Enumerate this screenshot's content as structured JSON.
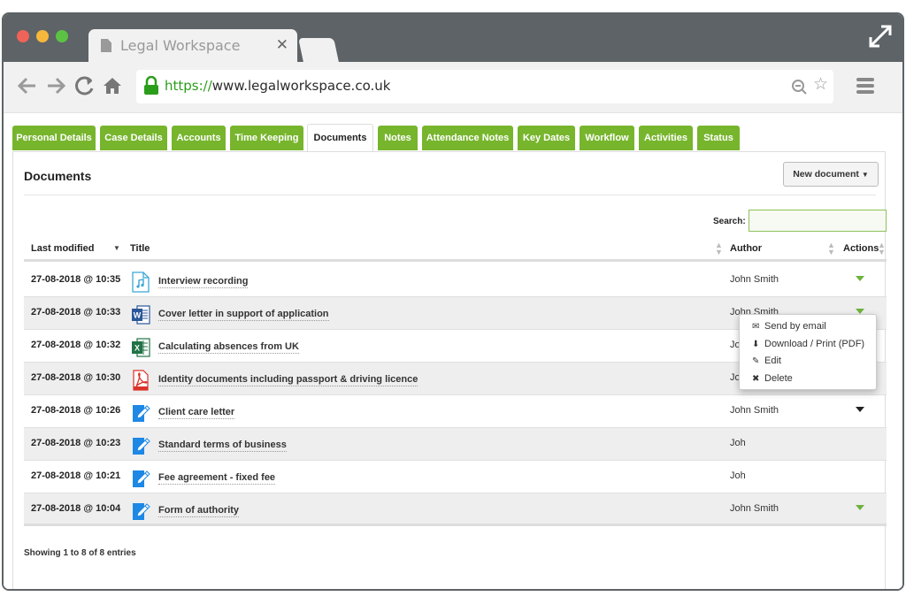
{
  "browser": {
    "tab_title": "Legal Workspace",
    "tab_close": "✕",
    "url_scheme": "https://",
    "url_host": "www.legalworkspace.co.uk"
  },
  "app_tabs": [
    {
      "label": "Personal Details",
      "active": false
    },
    {
      "label": "Case Details",
      "active": false
    },
    {
      "label": "Accounts",
      "active": false
    },
    {
      "label": "Time Keeping",
      "active": false
    },
    {
      "label": "Documents",
      "active": true
    },
    {
      "label": "Notes",
      "active": false
    },
    {
      "label": "Attendance Notes",
      "active": false
    },
    {
      "label": "Key Dates",
      "active": false
    },
    {
      "label": "Workflow",
      "active": false
    },
    {
      "label": "Activities",
      "active": false
    },
    {
      "label": "Status",
      "active": false
    }
  ],
  "panel": {
    "title": "Documents",
    "new_document_label": "New document",
    "search_label": "Search:",
    "search_value": ""
  },
  "table": {
    "columns": [
      "Last modified",
      "Title",
      "Author",
      "Actions"
    ],
    "rows": [
      {
        "date": "27-08-2018 @ 10:35",
        "title": "Interview recording",
        "author": "John Smith",
        "icon": "audio-file-icon"
      },
      {
        "date": "27-08-2018 @ 10:33",
        "title": "Cover letter in support of application",
        "author": "John Smith",
        "icon": "word-file-icon"
      },
      {
        "date": "27-08-2018 @ 10:32",
        "title": "Calculating absences from UK",
        "author": "John Smith",
        "icon": "excel-file-icon"
      },
      {
        "date": "27-08-2018 @ 10:30",
        "title": "Identity documents including passport & driving licence",
        "author": "John Smith",
        "icon": "pdf-file-icon"
      },
      {
        "date": "27-08-2018 @ 10:26",
        "title": "Client care letter",
        "author": "John Smith",
        "icon": "edit-document-icon"
      },
      {
        "date": "27-08-2018 @ 10:23",
        "title": "Standard terms of business",
        "author": "Joh",
        "icon": "edit-document-icon"
      },
      {
        "date": "27-08-2018 @ 10:21",
        "title": "Fee agreement - fixed fee",
        "author": "Joh",
        "icon": "edit-document-icon"
      },
      {
        "date": "27-08-2018 @ 10:04",
        "title": "Form of authority",
        "author": "John Smith",
        "icon": "edit-document-icon"
      }
    ],
    "footer": "Showing 1 to 8 of 8 entries"
  },
  "actions_menu": {
    "items": [
      {
        "label": "Send by email",
        "icon": "envelope-icon"
      },
      {
        "label": "Download / Print (PDF)",
        "icon": "download-icon"
      },
      {
        "label": "Edit",
        "icon": "pencil-icon"
      },
      {
        "label": "Delete",
        "icon": "delete-icon"
      }
    ]
  },
  "colors": {
    "accent_green": "#77b52d",
    "chrome_gray": "#5d6366"
  }
}
